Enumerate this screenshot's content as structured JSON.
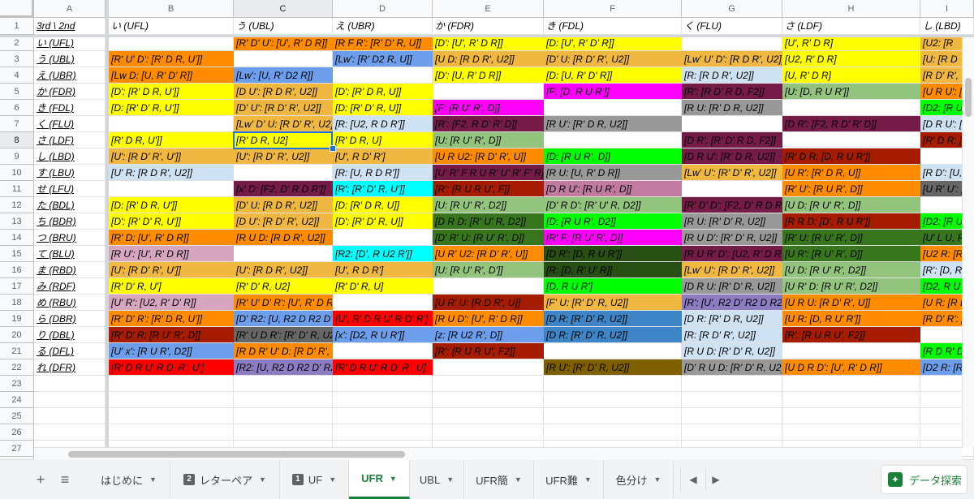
{
  "columns": [
    "A",
    "B",
    "C",
    "D",
    "E",
    "F",
    "G",
    "H",
    "I"
  ],
  "rows": [
    "1",
    "2",
    "3",
    "4",
    "5",
    "6",
    "7",
    "8",
    "9",
    "10",
    "11",
    "12",
    "13",
    "14",
    "15",
    "16",
    "17",
    "18",
    "19",
    "20",
    "21",
    "22",
    "23",
    "24",
    "25",
    "26",
    "27",
    "28"
  ],
  "header_row": [
    "3rd \\ 2nd",
    "い (UFL)",
    "う (UBL)",
    "え (UBR)",
    "か (FDR)",
    "き (FDL)",
    "く (FLU)",
    "さ (LDF)",
    "し (LBD)"
  ],
  "row_labels": [
    "い (UFL)",
    "う (UBL)",
    "え (UBR)",
    "か (FDR)",
    "き (FDL)",
    "く (FLU)",
    "さ (LDF)",
    "し (LBD)",
    "す (LBU)",
    "せ (LFU)",
    "た (BDL)",
    "ち (BDR)",
    "つ (BRU)",
    "て (BLU)",
    "ま (RBD)",
    "み (RDF)",
    "め (RBU)",
    "ら (DBR)",
    "り (DBL)",
    "る (DFL)",
    "れ (DFR)"
  ],
  "grid": [
    [
      [
        "",
        ""
      ],
      [
        "[R' D' U': [U', R' D R]]",
        "#ff8c00"
      ],
      [
        "[R F R': [R' D' R, U]]",
        "#ff8c00"
      ],
      [
        "[D': [U', R' D R]]",
        "#ffff00"
      ],
      [
        "[D: [U', R' D' R]]",
        "#ffff00"
      ],
      [
        "",
        ""
      ],
      [
        "[U', R' D R]",
        "#ffff00"
      ],
      [
        "[U2: [R",
        "#f0b840"
      ]
    ],
    [
      [
        "[R' U' D': [R' D R, U']]",
        "#ff8c00"
      ],
      [
        "",
        ""
      ],
      [
        "[Lw': [R' D2 R, U]]",
        "#6d9eeb"
      ],
      [
        "[U D: [R D R', U2]]",
        "#f0b840"
      ],
      [
        "[D' U: [R D' R', U2]]",
        "#f0b840"
      ],
      [
        "[Lw' U' D': [R D R', U2]]",
        "#f0b840"
      ],
      [
        "[U2, R' D R]",
        "#ffff00"
      ],
      [
        "[U: [R D",
        "#f0b840"
      ]
    ],
    [
      [
        "[Lw D: [U, R' D' R]]",
        "#ff8c00"
      ],
      [
        "[Lw': [U, R' D2 R]]",
        "#6d9eeb"
      ],
      [
        "",
        ""
      ],
      [
        "[D': [U, R' D R]]",
        "#ffff00"
      ],
      [
        "[D: [U, R' D' R]]",
        "#ffff00"
      ],
      [
        "[R: [R D R', U2]]",
        "#cfe2f3"
      ],
      [
        "[U, R' D R]",
        "#ffff00"
      ],
      [
        "[R D' R',",
        "#f0b840"
      ]
    ],
    [
      [
        "[D': [R' D R, U']]",
        "#ffff00"
      ],
      [
        "[D U': [R D R', U2]]",
        "#f0b840"
      ],
      [
        "[D': [R' D R, U]]",
        "#ffff00"
      ],
      [
        "",
        ""
      ],
      [
        "[F: [D, R U R']]",
        "#ff00ff"
      ],
      [
        "[R': [R D' R D, F2]]",
        "#741b47"
      ],
      [
        "[U: [D, R U R']]",
        "#93c47d"
      ],
      [
        "[U R U': [",
        "#ff8c00"
      ]
    ],
    [
      [
        "[D: [R' D' R, U']]",
        "#ffff00"
      ],
      [
        "[D' U': [R D' R', U2]]",
        "#f0b840"
      ],
      [
        "[D: [R' D' R, U]]",
        "#ffff00"
      ],
      [
        "[F: [R U' R', D]]",
        "#ff00ff"
      ],
      [
        "",
        ""
      ],
      [
        "[R U: [R' D R, U2]]",
        "#999999"
      ],
      [
        "",
        ""
      ],
      [
        "[D2: [R U",
        "#00ff00"
      ]
    ],
    [
      [
        "",
        ""
      ],
      [
        "[Lw' D' U: [R D' R', U2]]",
        "#f0b840"
      ],
      [
        "[R: [U2, R D R']]",
        "#cfe2f3"
      ],
      [
        "[R': [F2, R D' R' D]]",
        "#741b47"
      ],
      [
        "[R U': [R' D R, U2]]",
        "#999999"
      ],
      [
        "",
        ""
      ],
      [
        "[D R': [F2, R D' R' D]]",
        "#741b47"
      ],
      [
        "[D R U': [",
        "#cfe2f3"
      ]
    ],
    [
      [
        "[R' D R, U']]",
        "#ffff00"
      ],
      [
        "[R' D R, U2]",
        "#ffff00"
      ],
      [
        "[R' D R, U]",
        "#ffff00"
      ],
      [
        "[U: [R U' R', D]]",
        "#93c47d"
      ],
      [
        "",
        ""
      ],
      [
        "[D R': [R' D' R D, F2]]",
        "#741b47"
      ],
      [
        "",
        ""
      ],
      [
        "[R' D R: [",
        "#a61c00"
      ]
    ],
    [
      [
        "[U': [R D' R', U']]",
        "#f0b840"
      ],
      [
        "[U': [R D' R', U2]]",
        "#f0b840"
      ],
      [
        "[U', R D' R']",
        "#f0b840"
      ],
      [
        "[U R U2: [R D' R', U]]",
        "#ff8c00"
      ],
      [
        "[D: [R U R', D]]",
        "#00ff00"
      ],
      [
        "[D R U': [R' D R, U2]]",
        "#741b47"
      ],
      [
        "[R' D R: [D, R U R']]",
        "#a61c00"
      ],
      [
        "",
        ""
      ]
    ],
    [
      [
        "[U' R: [R D R', U2]]",
        "#cfe2f3"
      ],
      [
        "",
        ""
      ],
      [
        "[R: [U, R D R']]",
        "#cfe2f3"
      ],
      [
        "[U' R' F R U R' U' R' F' R]",
        "#741b47"
      ],
      [
        "[R U: [U, R' D R]]",
        "#999999"
      ],
      [
        "[Lw' U': [R' D' R', U2]]",
        "#f0b840"
      ],
      [
        "[U R': [R' D R, U]]",
        "#ff8c00"
      ],
      [
        "[R D': [U,",
        "#cfe2f3"
      ]
    ],
    [
      [
        "",
        ""
      ],
      [
        "[x' D: [F2, D' R D R']]",
        "#741b47"
      ],
      [
        "[R': [R' D' R, U']]",
        "#00ffff"
      ],
      [
        "[R': [R U R U', F]]",
        "#a61c00"
      ],
      [
        "[D R U': [R U R', D]]",
        "#c27ba0"
      ],
      [
        "",
        ""
      ],
      [
        "[R' U': [R U R', D]]",
        "#ff8c00"
      ],
      [
        "[U R' U': [",
        "#666666"
      ]
    ],
    [
      [
        "[D: [R' D R, U']]",
        "#ffff00"
      ],
      [
        "[D' U: [R D R', U2]]",
        "#f0b840"
      ],
      [
        "[D: [R' D R, U]]",
        "#ffff00"
      ],
      [
        "[U: [R U' R', D2]]",
        "#93c47d"
      ],
      [
        "[D' R D': [R' U' R, D2]]",
        "#93c47d"
      ],
      [
        "[R' D' D': [F2, D' R D R']]",
        "#741b47"
      ],
      [
        "[U D: [R U' R', D]]",
        "#93c47d"
      ],
      [
        "",
        ""
      ]
    ],
    [
      [
        "[D': [R' D' R, U']]",
        "#ffff00"
      ],
      [
        "[D U': [R D' R', U2]]",
        "#f0b840"
      ],
      [
        "[D': [R' D' R, U]]",
        "#ffff00"
      ],
      [
        "[D R D: [R' U' R, D2]]",
        "#38761d"
      ],
      [
        "[D: [R U R', D2]]",
        "#00ff00"
      ],
      [
        "[R U: [R' D' R, U2]]",
        "#999999"
      ],
      [
        "[R R D: [D', R U R']]",
        "#a61c00"
      ],
      [
        "[D2: [R U",
        "#00ff00"
      ]
    ],
    [
      [
        "[R' D: [U', R' D R]]",
        "#ff8c00"
      ],
      [
        "[R U D: [R D R', U2]]",
        "#ff8c00"
      ],
      [
        "",
        ""
      ],
      [
        "[D' R' U: [R U' R', D]]",
        "#38761d"
      ],
      [
        "[R' F: [R U' R', D]]",
        "#ff00ff"
      ],
      [
        "[R U D': [R' D' R, U2]]",
        "#999999"
      ],
      [
        "[R' U: [R U' R', D]]",
        "#38761d"
      ],
      [
        "[U' L U, R",
        "#38761d"
      ]
    ],
    [
      [
        "[R U': [U', R' D R]]",
        "#d5a6bd"
      ],
      [
        "",
        ""
      ],
      [
        "[R2: [D', R U2 R']]",
        "#00ffff"
      ],
      [
        "[U R' U2: [R D' R', U]]",
        "#ff8c00"
      ],
      [
        "[D R': [D, R U R']]",
        "#274e13"
      ],
      [
        "[R U R' D': [U2, R' D R D]]",
        "#741b47"
      ],
      [
        "[U R': [R U' R', D]]",
        "#38761d"
      ],
      [
        "[U2 R: [R",
        "#ff8c00"
      ]
    ],
    [
      [
        "[U': [R D' R', U']]",
        "#f0b840"
      ],
      [
        "[U': [R D R', U2]]",
        "#f0b840"
      ],
      [
        "[U', R D R']",
        "#f0b840"
      ],
      [
        "[U: [R U' R', D']]",
        "#93c47d"
      ],
      [
        "[R: [D, R' U' R]]",
        "#274e13"
      ],
      [
        "[Lw' U': [R D' R', U2]]",
        "#f0b840"
      ],
      [
        "[U D: [R U' R', D2]]",
        "#93c47d"
      ],
      [
        "[R': [D, R",
        "#cfe2f3"
      ]
    ],
    [
      [
        "[R' D' R, U']",
        "#ffff00"
      ],
      [
        "[R' D' R, U2]",
        "#ffff00"
      ],
      [
        "[R' D' R, U]",
        "#ffff00"
      ],
      [
        "",
        ""
      ],
      [
        "[D, R U R']",
        "#00ff00"
      ],
      [
        "[D R U: [R' D' R, U2]]",
        "#999999"
      ],
      [
        "[U R' D: [R U' R', D2]]",
        "#93c47d"
      ],
      [
        "[D2, R U",
        "#00ff00"
      ]
    ],
    [
      [
        "[U' R': [U2, R' D' R]]",
        "#d5a6bd"
      ],
      [
        "[R' U' D' R': [U', R' D R]]",
        "#ff8c00"
      ],
      [
        "",
        ""
      ],
      [
        "[U R' U: [R D R', U]]",
        "#a61c00"
      ],
      [
        "[F' U: [R' D' R, U2]]",
        "#f0b840"
      ],
      [
        "[R': [U', R2 D' R2 D R2]]",
        "#8e7cc3"
      ],
      [
        "[U R U: [R D' R', U]]",
        "#ff8c00"
      ],
      [
        "[U R: [R D",
        "#ff8c00"
      ]
    ],
    [
      [
        "[R' D' R': [R' D R, U']]",
        "#ff8c00"
      ],
      [
        "[D' R2: [U, R2 D R2 D' R2]]",
        "#6d9eeb"
      ],
      [
        "[U', R' D R U' R D' R']",
        "#ff0000"
      ],
      [
        "[R U D': [U', R' D R]]",
        "#ff8c00"
      ],
      [
        "[D R: [R' D' R, U2]]",
        "#3d85c6"
      ],
      [
        "[D R: [R' D R, U2]]",
        "#cfe2f3"
      ],
      [
        "[U R: [D, R U' R']]",
        "#ff8c00"
      ],
      [
        "[R D' R': [",
        "#ff8c00"
      ]
    ],
    [
      [
        "[R' D' R: [R U' R', D]]",
        "#a61c00"
      ],
      [
        "[R' U D R': [R' D' R, U2]]",
        "#666666"
      ],
      [
        "[x': [D2, R U R']]",
        "#6d9eeb"
      ],
      [
        "[z: [R U2 R', D]]",
        "#6d9eeb"
      ],
      [
        "[D R: [R' D' R, U2]]",
        "#3d85c6"
      ],
      [
        "[R: [R D' R', U2]]",
        "#cfe2f3"
      ],
      [
        "[R': [R U R U', F2]]",
        "#a61c00"
      ],
      [
        "",
        ""
      ]
    ],
    [
      [
        "[U' x': [R U R', D2]]",
        "#6d9eeb"
      ],
      [
        "[R D R' U' D: [R D' R', U2]]",
        "#ff8c00"
      ],
      [
        "",
        ""
      ],
      [
        "[R': [R U R U', F2]]",
        "#a61c00"
      ],
      [
        "",
        ""
      ],
      [
        "[R U D: [R' D' R, U2]]",
        "#cfe2f3"
      ],
      [
        "",
        ""
      ],
      [
        "[R D R' D",
        "#00ff00"
      ]
    ],
    [
      [
        "[R' D R U' R D' R', U']",
        "#ff0000"
      ],
      [
        "[R2: [U, R2 D R2 D' R2]]",
        "#8e7cc3"
      ],
      [
        "[R' D R U' R D' R', U]",
        "#ff0000"
      ],
      [
        "",
        ""
      ],
      [
        "[R U': [R' D' R, U2]]",
        "#7f6000"
      ],
      [
        "[D' R U D: [R' D' R, U2]]",
        "#999999"
      ],
      [
        "[U D R D': [U', R' D R]]",
        "#ff8c00"
      ],
      [
        "[D2 R: [R",
        "#6d9eeb"
      ]
    ]
  ],
  "selected_cell": "C8",
  "tabs": [
    {
      "label": "はじめに",
      "badge": ""
    },
    {
      "label": "レターペア",
      "badge": "2"
    },
    {
      "label": "UF",
      "badge": "1"
    },
    {
      "label": "UFR",
      "badge": ""
    },
    {
      "label": "UBL",
      "badge": ""
    },
    {
      "label": "UFR簡",
      "badge": ""
    },
    {
      "label": "UFR難",
      "badge": ""
    },
    {
      "label": "色分け",
      "badge": ""
    }
  ],
  "active_tab": "UFR",
  "add_sheet_icon": "+",
  "all_sheets_icon": "≡",
  "explore_label": "データ探索",
  "scroll_prev_icon": "◀",
  "scroll_next_icon": "▶"
}
